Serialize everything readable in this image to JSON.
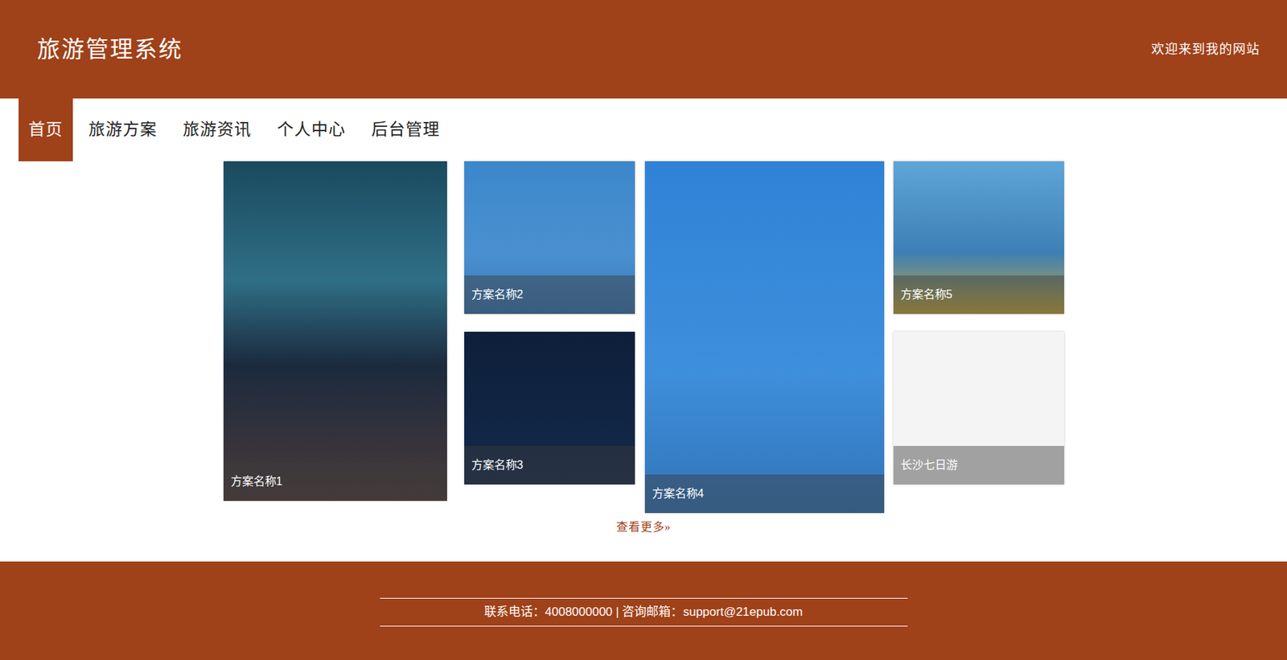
{
  "header": {
    "title": "旅游管理系统",
    "welcome": "欢迎来到我的网站"
  },
  "nav": [
    {
      "label": "首页",
      "selected": true
    },
    {
      "label": "旅游方案",
      "selected": false
    },
    {
      "label": "旅游资讯",
      "selected": false
    },
    {
      "label": "个人中心",
      "selected": false
    },
    {
      "label": "后台管理",
      "selected": false
    }
  ],
  "plans": [
    {
      "title": "方案名称1"
    },
    {
      "title": "方案名称2"
    },
    {
      "title": "方案名称3"
    },
    {
      "title": "方案名称4"
    },
    {
      "title": "方案名称5"
    },
    {
      "title": "长沙七日游"
    }
  ],
  "more": {
    "label": "查看更多",
    "icon": "»"
  },
  "footer": {
    "contact": "联系电话：4008000000 | 咨询邮箱：support@21epub.com"
  }
}
